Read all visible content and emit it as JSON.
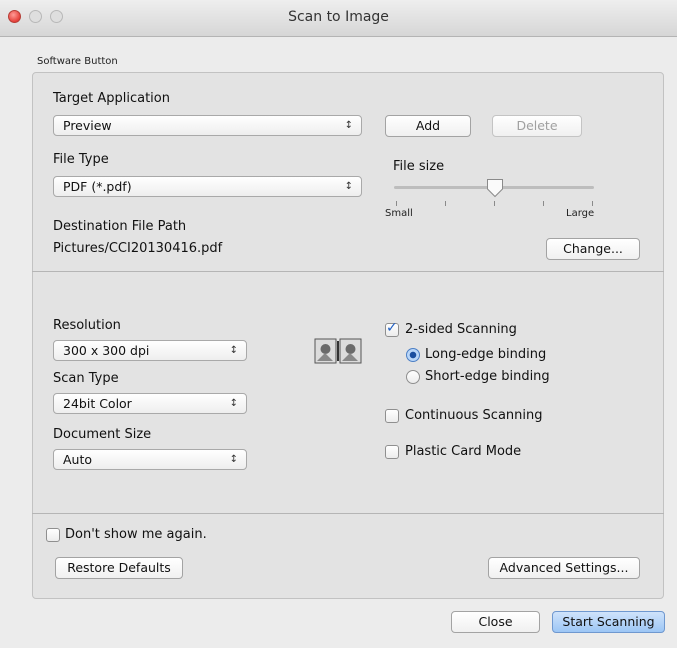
{
  "window": {
    "title": "Scan to Image"
  },
  "group_label": "Software Button",
  "target_application": {
    "label": "Target Application",
    "selected": "Preview",
    "add_button": "Add",
    "delete_button": "Delete"
  },
  "file_type": {
    "label": "File Type",
    "selected": "PDF (*.pdf)"
  },
  "file_size": {
    "label": "File size",
    "min_label": "Small",
    "max_label": "Large",
    "value_fraction": 0.5
  },
  "destination": {
    "label": "Destination File Path",
    "path": "Pictures/CCI20130416.pdf",
    "change_button": "Change..."
  },
  "resolution": {
    "label": "Resolution",
    "selected": "300 x 300 dpi"
  },
  "scan_type": {
    "label": "Scan Type",
    "selected": "24bit Color"
  },
  "document_size": {
    "label": "Document Size",
    "selected": "Auto"
  },
  "two_sided": {
    "label": "2-sided Scanning",
    "checked": true,
    "long_edge": "Long-edge binding",
    "short_edge": "Short-edge binding",
    "selected": "long"
  },
  "continuous": {
    "label": "Continuous Scanning",
    "checked": false
  },
  "plastic_card": {
    "label": "Plastic Card Mode",
    "checked": false
  },
  "dont_show": {
    "label": "Don't show me again.",
    "checked": false
  },
  "buttons": {
    "restore_defaults": "Restore Defaults",
    "advanced_settings": "Advanced Settings...",
    "close": "Close",
    "start_scanning": "Start Scanning"
  },
  "icons": {
    "arrows": "↕",
    "check": "✓"
  },
  "colors": {
    "primary_button": "#9cc6f5",
    "close_light": "#e5403a"
  }
}
